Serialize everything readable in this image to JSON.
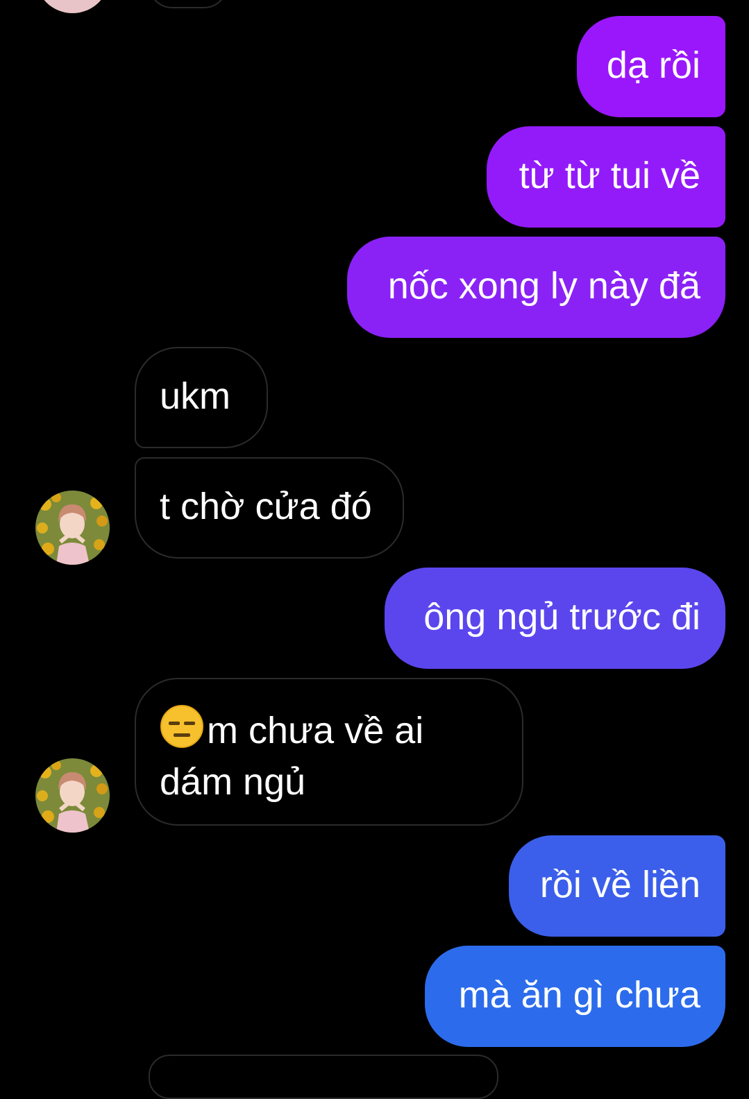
{
  "conversation": {
    "messages": [
      {
        "direction": "sent",
        "text": "dạ rồi",
        "color": "#9A17FB"
      },
      {
        "direction": "sent",
        "text": "từ từ tui về",
        "color": "#931BFA"
      },
      {
        "direction": "sent",
        "text": "nốc xong ly này đã",
        "color": "#8A22F6"
      },
      {
        "direction": "received",
        "text": "ukm"
      },
      {
        "direction": "received",
        "text": "t chờ cửa đó"
      },
      {
        "direction": "sent",
        "text": "ông ngủ trước đi",
        "color": "#5B46EE"
      },
      {
        "direction": "received",
        "emoji": "expressionless-face-icon",
        "line1": "m chưa về ai",
        "line2": "dám ngủ"
      },
      {
        "direction": "sent",
        "text": "rồi về liền",
        "color": "#3B5FEA"
      },
      {
        "direction": "sent",
        "text": "mà ăn gì chưa",
        "color": "#2C6CEC"
      }
    ]
  },
  "colors": {
    "background": "#000000",
    "received_border": "#2B2B2B",
    "text": "#FFFFFF"
  }
}
